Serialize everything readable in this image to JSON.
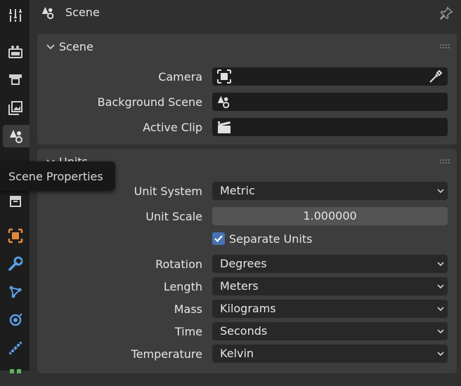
{
  "header": {
    "title": "Scene"
  },
  "tabs": [
    {
      "name": "tool-icon"
    },
    {
      "name": "render-icon"
    },
    {
      "name": "output-icon"
    },
    {
      "name": "view-layer-icon"
    },
    {
      "name": "scene-icon",
      "active": true
    },
    {
      "name": "world-icon"
    },
    {
      "name": "collection-icon"
    },
    {
      "name": "object-icon"
    },
    {
      "name": "modifier-icon"
    },
    {
      "name": "particles-icon"
    },
    {
      "name": "physics-icon"
    },
    {
      "name": "constraints-icon"
    },
    {
      "name": "data-icon"
    }
  ],
  "tooltip": {
    "text": "Scene Properties"
  },
  "scene_panel": {
    "title": "Scene",
    "camera_label": "Camera",
    "background_scene_label": "Background Scene",
    "active_clip_label": "Active Clip"
  },
  "units_panel": {
    "title": "Units",
    "unit_system_label": "Unit System",
    "unit_system_value": "Metric",
    "unit_scale_label": "Unit Scale",
    "unit_scale_value": "1.000000",
    "separate_units_label": "Separate Units",
    "separate_units_checked": true,
    "rotation_label": "Rotation",
    "rotation_value": "Degrees",
    "length_label": "Length",
    "length_value": "Meters",
    "mass_label": "Mass",
    "mass_value": "Kilograms",
    "time_label": "Time",
    "time_value": "Seconds",
    "temperature_label": "Temperature",
    "temperature_value": "Kelvin"
  },
  "colors": {
    "accent": "#4772b3",
    "background": "#303030",
    "panel": "#3d3d3d",
    "field": "#1d1d1d",
    "tabbar": "#1d1d1d"
  }
}
